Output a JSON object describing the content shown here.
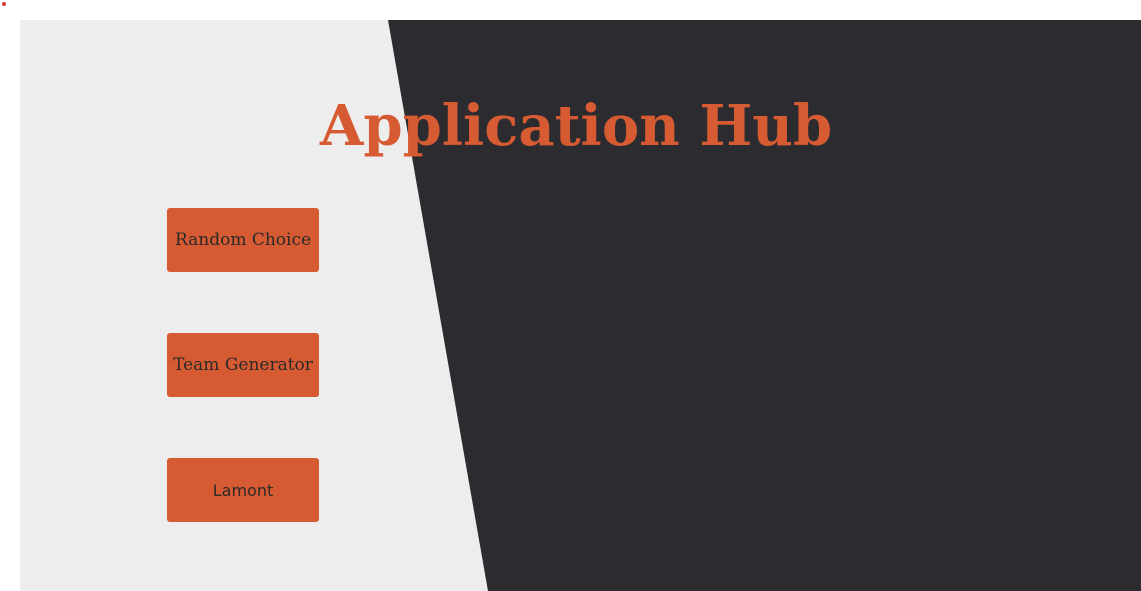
{
  "page": {
    "title": "Application Hub"
  },
  "colors": {
    "accent": "#d65a32",
    "light_panel": "#ededed",
    "dark_panel": "#2b2b30",
    "button_text": "#2a2a2a"
  },
  "apps": [
    {
      "label": "Random Choice"
    },
    {
      "label": "Team Generator"
    },
    {
      "label": "Lamont"
    }
  ]
}
